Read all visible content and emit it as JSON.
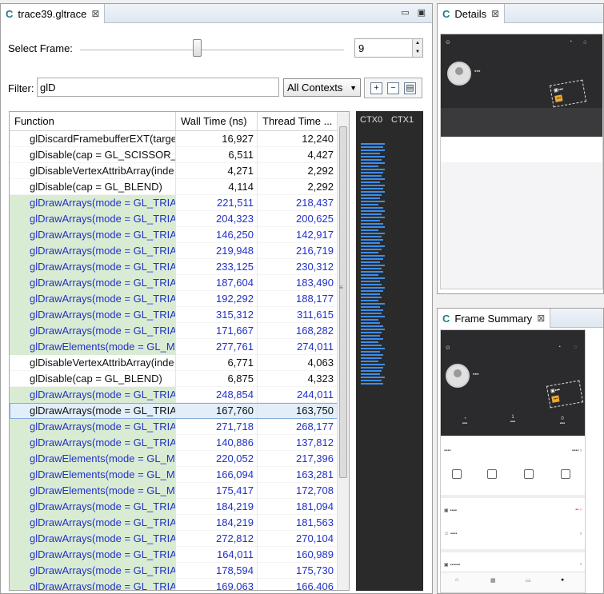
{
  "editor": {
    "tab_title": "trace39.gltrace",
    "select_frame_label": "Select Frame:",
    "frame_value": "9",
    "frame_fraction": 0.45,
    "filter_label": "Filter:",
    "filter_value": "glD",
    "context_select": "All Contexts"
  },
  "table": {
    "columns": [
      "Function",
      "Wall Time (ns)",
      "Thread Time ..."
    ],
    "rows": [
      {
        "fn": "glDiscardFramebufferEXT(targe",
        "wall": "16,927",
        "thread": "12,240",
        "kind": "plain"
      },
      {
        "fn": "glDisable(cap = GL_SCISSOR_TE",
        "wall": "6,511",
        "thread": "4,427",
        "kind": "plain"
      },
      {
        "fn": "glDisableVertexAttribArray(inde",
        "wall": "4,271",
        "thread": "2,292",
        "kind": "plain"
      },
      {
        "fn": "glDisable(cap = GL_BLEND)",
        "wall": "4,114",
        "thread": "2,292",
        "kind": "plain"
      },
      {
        "fn": "glDrawArrays(mode = GL_TRIAI",
        "wall": "221,511",
        "thread": "218,437",
        "kind": "draw"
      },
      {
        "fn": "glDrawArrays(mode = GL_TRIAI",
        "wall": "204,323",
        "thread": "200,625",
        "kind": "draw"
      },
      {
        "fn": "glDrawArrays(mode = GL_TRIAI",
        "wall": "146,250",
        "thread": "142,917",
        "kind": "draw"
      },
      {
        "fn": "glDrawArrays(mode = GL_TRIAI",
        "wall": "219,948",
        "thread": "216,719",
        "kind": "draw"
      },
      {
        "fn": "glDrawArrays(mode = GL_TRIAI",
        "wall": "233,125",
        "thread": "230,312",
        "kind": "draw"
      },
      {
        "fn": "glDrawArrays(mode = GL_TRIAI",
        "wall": "187,604",
        "thread": "183,490",
        "kind": "draw"
      },
      {
        "fn": "glDrawArrays(mode = GL_TRIAI",
        "wall": "192,292",
        "thread": "188,177",
        "kind": "draw"
      },
      {
        "fn": "glDrawArrays(mode = GL_TRIAI",
        "wall": "315,312",
        "thread": "311,615",
        "kind": "draw"
      },
      {
        "fn": "glDrawArrays(mode = GL_TRIAI",
        "wall": "171,667",
        "thread": "168,282",
        "kind": "draw"
      },
      {
        "fn": "glDrawElements(mode = GL_MA",
        "wall": "277,761",
        "thread": "274,011",
        "kind": "draw"
      },
      {
        "fn": "glDisableVertexAttribArray(inde",
        "wall": "6,771",
        "thread": "4,063",
        "kind": "plain"
      },
      {
        "fn": "glDisable(cap = GL_BLEND)",
        "wall": "6,875",
        "thread": "4,323",
        "kind": "plain"
      },
      {
        "fn": "glDrawArrays(mode = GL_TRIAI",
        "wall": "248,854",
        "thread": "244,011",
        "kind": "draw"
      },
      {
        "fn": "glDrawArrays(mode = GL_TRIAI",
        "wall": "167,760",
        "thread": "163,750",
        "kind": "sel"
      },
      {
        "fn": "glDrawArrays(mode = GL_TRIAI",
        "wall": "271,718",
        "thread": "268,177",
        "kind": "draw"
      },
      {
        "fn": "glDrawArrays(mode = GL_TRIAI",
        "wall": "140,886",
        "thread": "137,812",
        "kind": "draw"
      },
      {
        "fn": "glDrawElements(mode = GL_MA",
        "wall": "220,052",
        "thread": "217,396",
        "kind": "draw"
      },
      {
        "fn": "glDrawElements(mode = GL_MA",
        "wall": "166,094",
        "thread": "163,281",
        "kind": "draw"
      },
      {
        "fn": "glDrawElements(mode = GL_MA",
        "wall": "175,417",
        "thread": "172,708",
        "kind": "draw"
      },
      {
        "fn": "glDrawArrays(mode = GL_TRIAI",
        "wall": "184,219",
        "thread": "181,094",
        "kind": "draw"
      },
      {
        "fn": "glDrawArrays(mode = GL_TRIAI",
        "wall": "184,219",
        "thread": "181,563",
        "kind": "draw"
      },
      {
        "fn": "glDrawArrays(mode = GL_TRIAI",
        "wall": "272,812",
        "thread": "270,104",
        "kind": "draw"
      },
      {
        "fn": "glDrawArrays(mode = GL_TRIAI",
        "wall": "164,011",
        "thread": "160,989",
        "kind": "draw"
      },
      {
        "fn": "glDrawArrays(mode = GL_TRIAI",
        "wall": "178,594",
        "thread": "175,730",
        "kind": "draw"
      },
      {
        "fn": "glDrawArrays(mode = GL_TRIAI",
        "wall": "169,063",
        "thread": "166,406",
        "kind": "draw"
      }
    ]
  },
  "timeline": {
    "contexts": [
      "CTX0",
      "CTX1"
    ],
    "bar_color": "#3d8eea"
  },
  "details": {
    "tab_title": "Details"
  },
  "summary": {
    "tab_title": "Frame Summary"
  },
  "colors": {
    "draw_row_bg": "#d9ecd3",
    "draw_text": "#2232c8",
    "selection_bg": "#e3eefb",
    "accent": "#1f7a8c"
  }
}
